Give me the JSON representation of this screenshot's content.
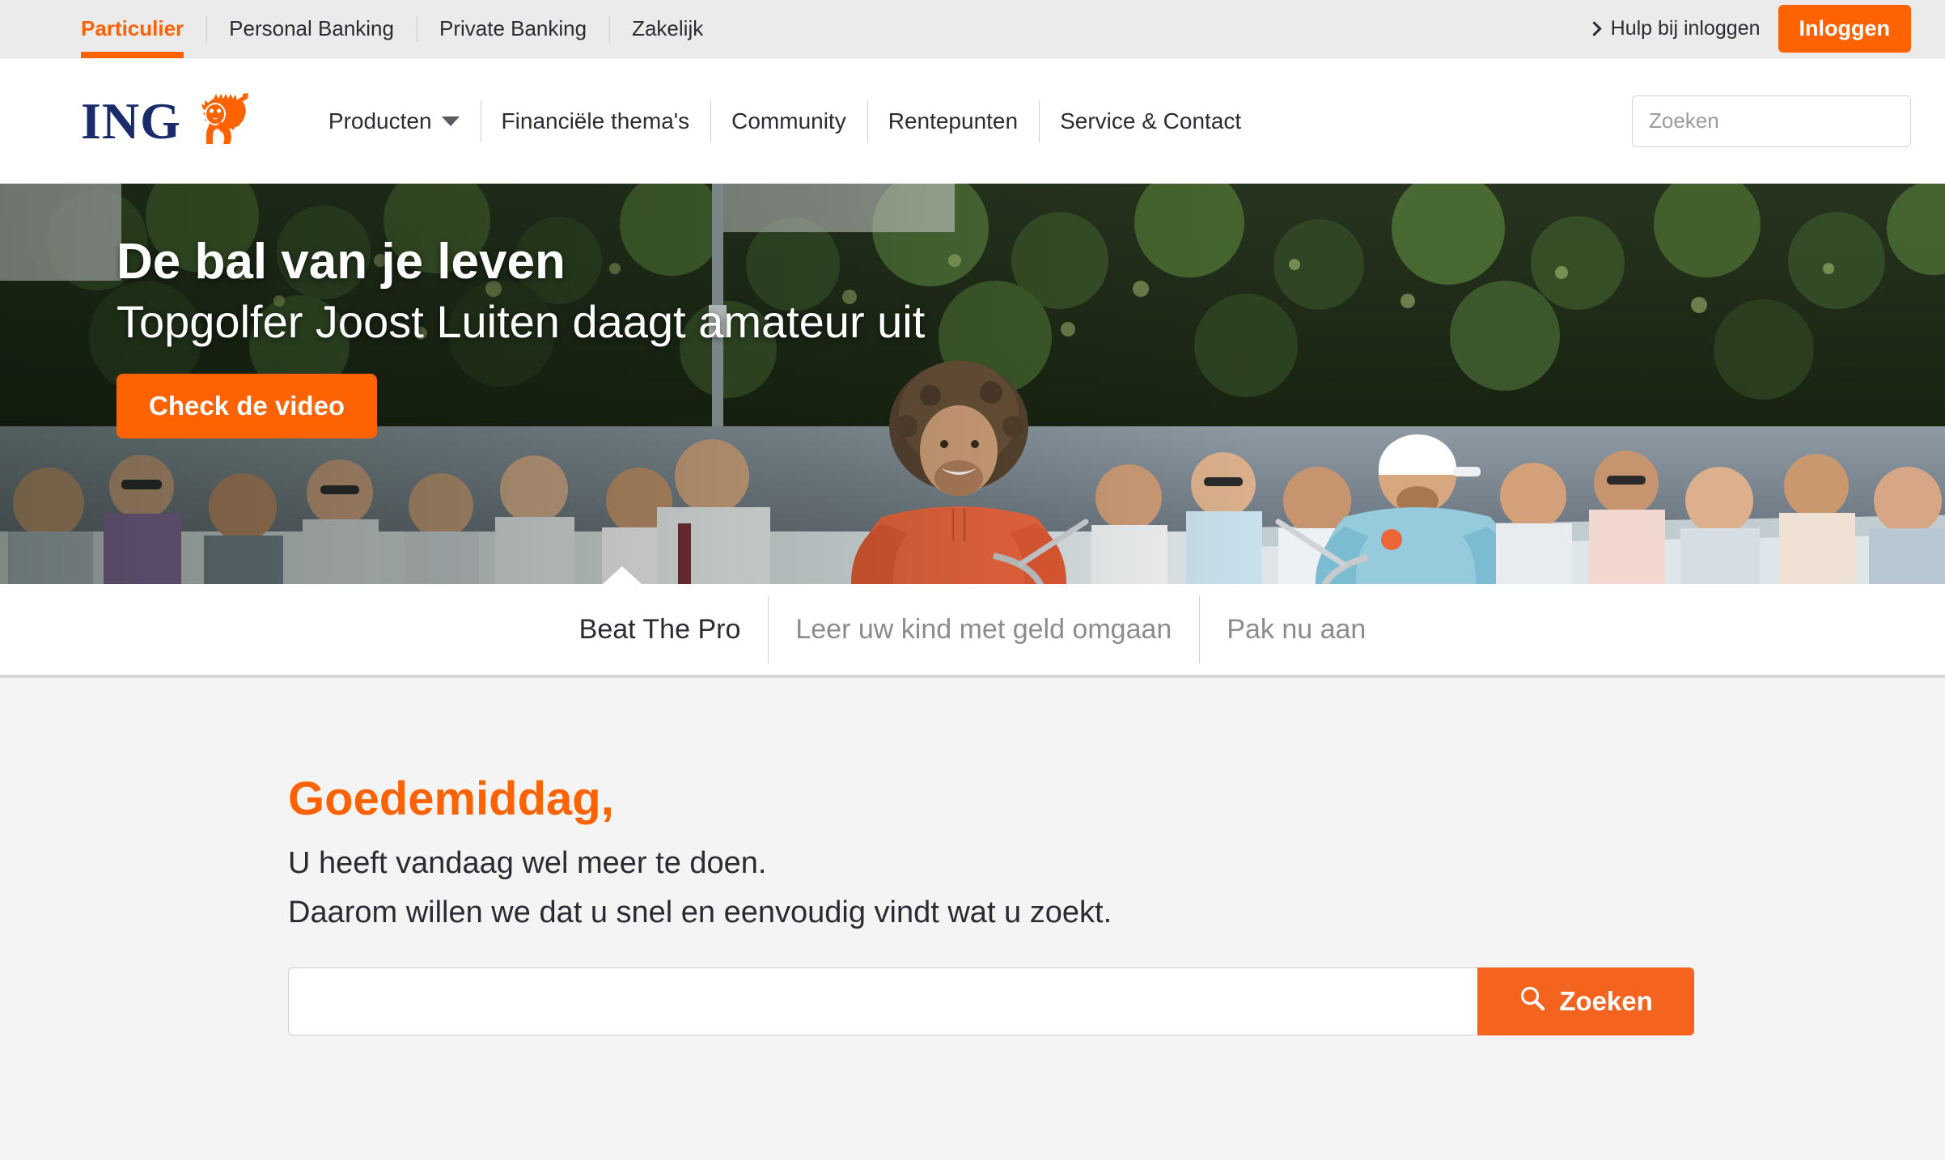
{
  "topbar": {
    "segments": [
      {
        "label": "Particulier",
        "active": true
      },
      {
        "label": "Personal Banking",
        "active": false
      },
      {
        "label": "Private Banking",
        "active": false
      },
      {
        "label": "Zakelijk",
        "active": false
      }
    ],
    "help_link": "Hulp bij inloggen",
    "login_button": "Inloggen"
  },
  "header": {
    "brand": "ING",
    "nav": [
      {
        "label": "Producten",
        "has_caret": true
      },
      {
        "label": "Financiële thema's",
        "has_caret": false
      },
      {
        "label": "Community",
        "has_caret": false
      },
      {
        "label": "Rentepunten",
        "has_caret": false
      },
      {
        "label": "Service & Contact",
        "has_caret": false
      }
    ],
    "search": {
      "placeholder": "Zoeken",
      "value": ""
    }
  },
  "hero": {
    "title": "De bal van je leven",
    "subtitle": "Topgolfer Joost Luiten daagt amateur uit",
    "cta": "Check de video"
  },
  "carousel": {
    "tabs": [
      {
        "label": "Beat The Pro",
        "active": true
      },
      {
        "label": "Leer uw kind met geld omgaan",
        "active": false
      },
      {
        "label": "Pak nu aan",
        "active": false
      }
    ]
  },
  "main": {
    "greeting": "Goedemiddag,",
    "line1": "U heeft vandaag wel meer te doen.",
    "line2": "Daarom willen we dat u snel en eenvoudig vindt wat u zoekt.",
    "search": {
      "placeholder": "",
      "value": "",
      "button_label": "Zoeken"
    }
  },
  "colors": {
    "accent_orange": "#ff6200",
    "button_orange": "#f4641e",
    "brand_navy": "#1a2b6b",
    "content_bg": "#f4f4f4",
    "topbar_bg": "#ebebeb"
  }
}
